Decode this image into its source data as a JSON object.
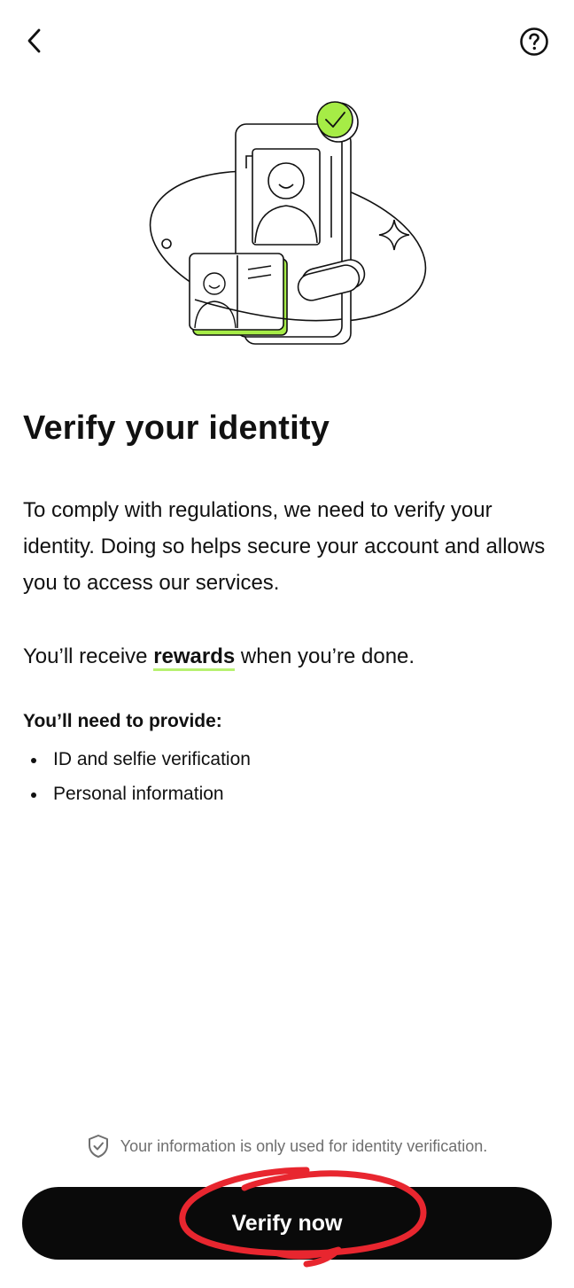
{
  "header": {
    "back_icon": "chevron-left-icon",
    "help_icon": "question-circle-icon"
  },
  "hero": {
    "illustration": "identity-verification-illustration",
    "accent_color": "#a6ec46"
  },
  "content": {
    "title": "Verify your identity",
    "description": "To comply with regulations, we need to verify your identity. Doing so helps secure your account and allows you to access our services.",
    "rewards": {
      "prefix": "You’ll receive ",
      "link": "rewards",
      "suffix": " when you’re done."
    },
    "requirements": {
      "title": "You’ll need to provide:",
      "items": [
        "ID and selfie verification",
        "Personal information"
      ]
    }
  },
  "footer": {
    "notice_icon": "shield-check-icon",
    "notice": "Your information is only used for identity verification.",
    "cta_label": "Verify now",
    "cta_color": "#0a0a0a",
    "annotation_color": "#e8262f"
  }
}
